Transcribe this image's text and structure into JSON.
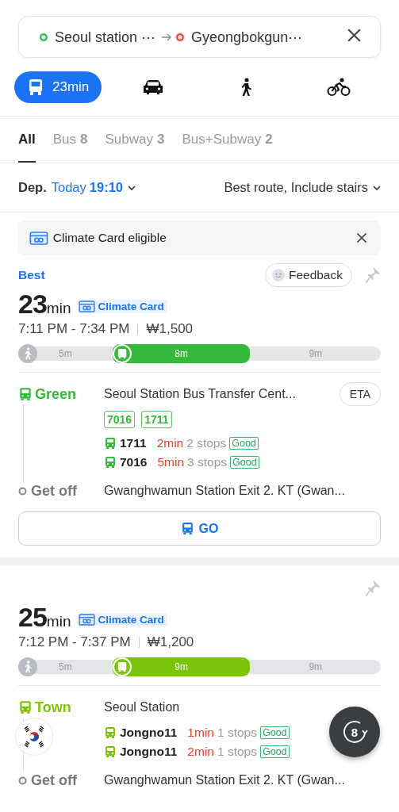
{
  "search": {
    "origin": "Seoul station ⋯",
    "destination": "Gyeongbokgun⋯"
  },
  "modes": [
    {
      "kind": "transit",
      "label": "23min",
      "selected": true
    },
    {
      "kind": "car",
      "selected": false
    },
    {
      "kind": "walk",
      "selected": false
    },
    {
      "kind": "bike",
      "selected": false
    }
  ],
  "filters": [
    {
      "label": "All",
      "selected": true
    },
    {
      "label": "Bus",
      "count": "8",
      "selected": false
    },
    {
      "label": "Subway",
      "count": "3",
      "selected": false
    },
    {
      "label": "Bus+Subway",
      "count": "2",
      "selected": false
    }
  ],
  "departure": {
    "label": "Dep.",
    "day": "Today",
    "time": "19:10",
    "options": "Best route, Include stairs"
  },
  "banner": {
    "text": "Climate Card eligible"
  },
  "routes": [
    {
      "tag": "Best",
      "feedback": "Feedback",
      "duration": "23",
      "unit": "min",
      "badge": "Climate Card",
      "times": "7:11 PM - 7:34 PM",
      "fare": "₩1,500",
      "segments": [
        {
          "kind": "walk",
          "label": "5m"
        },
        {
          "kind": "bus",
          "label": "8m"
        },
        {
          "kind": "tail",
          "label": "9m"
        }
      ],
      "leg": {
        "line": "Green",
        "color": "#35b93a",
        "stop": "Seoul Station Bus Transfer Cent...",
        "eta": "ETA",
        "chips": [
          "7016",
          "1711"
        ],
        "arrivals": [
          {
            "bus": "1711",
            "wait": "2min",
            "stops": "2 stops",
            "crowd": "Good"
          },
          {
            "bus": "7016",
            "wait": "5min",
            "stops": "3 stops",
            "crowd": "Good"
          }
        ]
      },
      "get_off": {
        "label": "Get off",
        "stop": "Gwanghwamun Station Exit 2. KT (Gwan..."
      },
      "go": "GO"
    },
    {
      "duration": "25",
      "unit": "min",
      "badge": "Climate Card",
      "times": "7:12 PM - 7:37 PM",
      "fare": "₩1,200",
      "segments": [
        {
          "kind": "walk",
          "label": "5m"
        },
        {
          "kind": "bus",
          "label": "9m"
        },
        {
          "kind": "tail",
          "label": "9m"
        }
      ],
      "leg": {
        "line": "Town",
        "color": "#7cc40a",
        "stop": "Seoul Station",
        "arrivals": [
          {
            "bus": "Jongno11",
            "wait": "1min",
            "stops": "1 stops",
            "crowd": "Good"
          },
          {
            "bus": "Jongno11",
            "wait": "2min",
            "stops": "1 stops",
            "crowd": "Good"
          }
        ]
      },
      "get_off": {
        "label": "Get off",
        "stop": "Gwanghwamun Station Exit 2. KT (Gwan..."
      }
    }
  ],
  "floating": {
    "avatar": {
      "kind": "flag"
    },
    "count": "8"
  }
}
